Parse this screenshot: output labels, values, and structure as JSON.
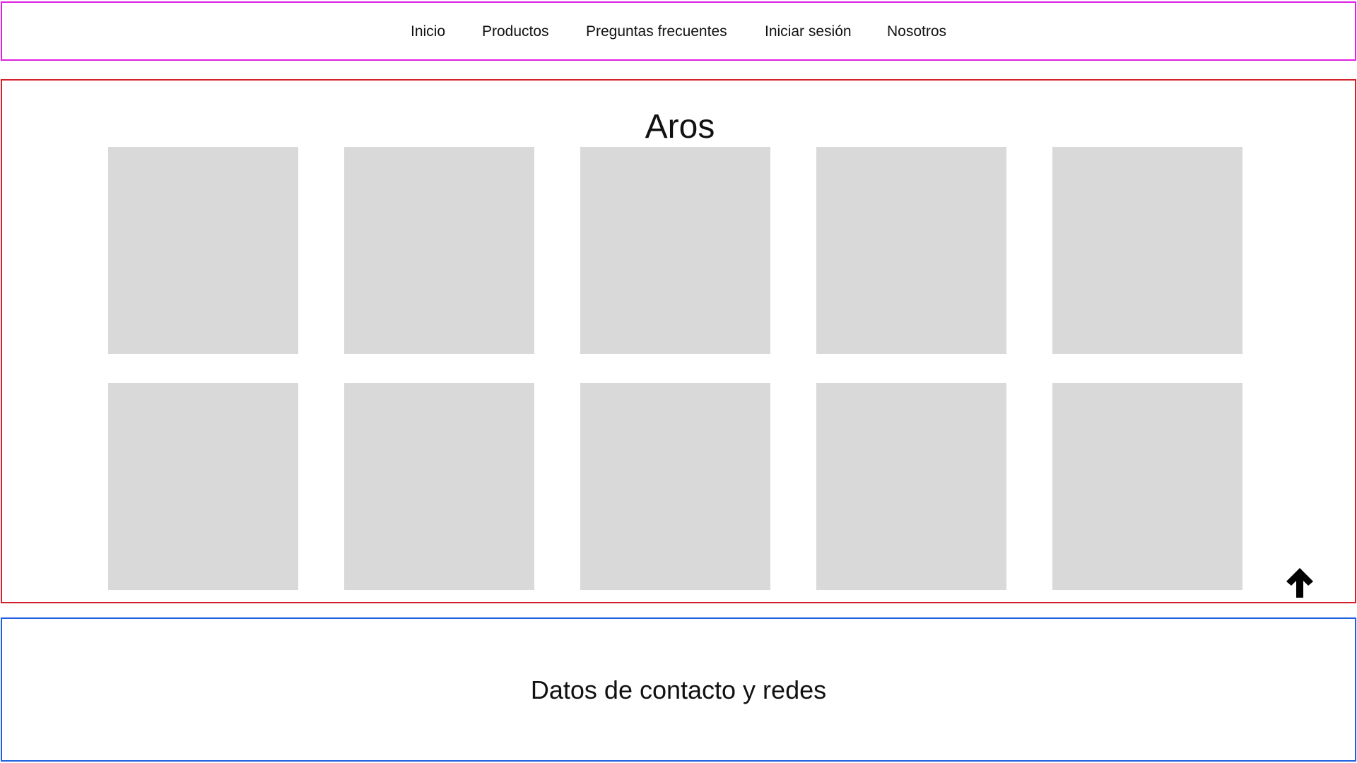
{
  "nav": {
    "items": [
      {
        "label": "Inicio"
      },
      {
        "label": "Productos"
      },
      {
        "label": "Preguntas frecuentes"
      },
      {
        "label": "Iniciar sesión"
      },
      {
        "label": "Nosotros"
      }
    ]
  },
  "main": {
    "title": "Aros",
    "products": [
      {
        "placeholder": "product-image"
      },
      {
        "placeholder": "product-image"
      },
      {
        "placeholder": "product-image"
      },
      {
        "placeholder": "product-image"
      },
      {
        "placeholder": "product-image"
      },
      {
        "placeholder": "product-image"
      },
      {
        "placeholder": "product-image"
      },
      {
        "placeholder": "product-image"
      },
      {
        "placeholder": "product-image"
      },
      {
        "placeholder": "product-image"
      }
    ],
    "back_to_top_icon": "arrow-up-icon"
  },
  "footer": {
    "text": "Datos de contacto y redes"
  },
  "colors": {
    "nav_border": "#e11ee1",
    "main_border": "#d3222b",
    "footer_border": "#1f5fe0",
    "placeholder": "#d9d9d9"
  }
}
